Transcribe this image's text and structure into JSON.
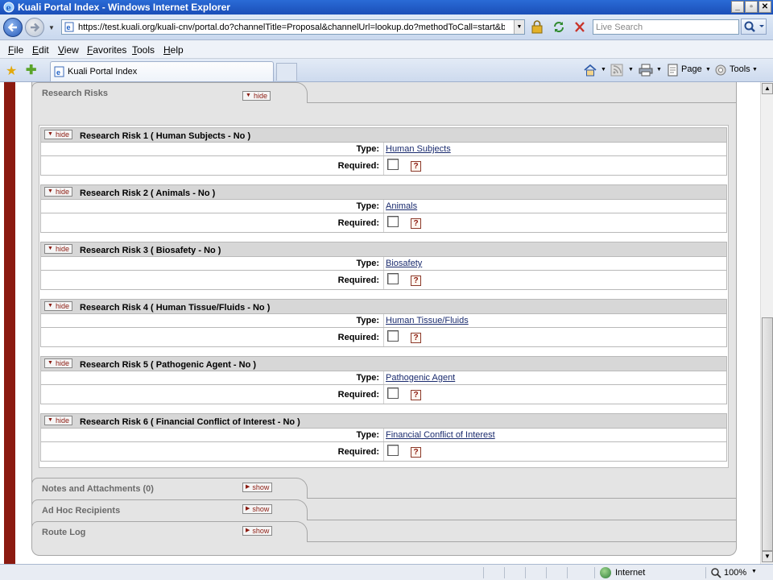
{
  "window": {
    "title": "Kuali Portal Index - Windows Internet Explorer"
  },
  "address": {
    "url": "https://test.kuali.org/kuali-cnv/portal.do?channelTitle=Proposal&channelUrl=lookup.do?methodToCall=start&businessObje",
    "search_placeholder": "Live Search"
  },
  "menu": [
    "File",
    "Edit",
    "View",
    "Favorites",
    "Tools",
    "Help"
  ],
  "tab": {
    "label": "Kuali Portal Index"
  },
  "commandbar": {
    "page_label": "Page",
    "tools_label": "Tools"
  },
  "research_risks": {
    "title": "Research Risks",
    "toggle": "hide",
    "type_label": "Type:",
    "required_label": "Required:",
    "help_glyph": "?",
    "items": [
      {
        "toggle": "hide",
        "title": "Research Risk 1 ( Human Subjects - No )",
        "type": "Human Subjects",
        "required": false
      },
      {
        "toggle": "hide",
        "title": "Research Risk 2 ( Animals - No )",
        "type": "Animals",
        "required": false
      },
      {
        "toggle": "hide",
        "title": "Research Risk 3 ( Biosafety - No )",
        "type": "Biosafety",
        "required": false
      },
      {
        "toggle": "hide",
        "title": "Research Risk 4 ( Human Tissue/Fluids - No )",
        "type": "Human Tissue/Fluids",
        "required": false
      },
      {
        "toggle": "hide",
        "title": "Research Risk 5 ( Pathogenic Agent - No )",
        "type": "Pathogenic Agent",
        "required": false
      },
      {
        "toggle": "hide",
        "title": "Research Risk 6 ( Financial Conflict of Interest - No )",
        "type": "Financial Conflict of Interest",
        "required": false
      }
    ]
  },
  "collapsed_sections": [
    {
      "title": "Notes and Attachments (0)",
      "toggle": "show"
    },
    {
      "title": "Ad Hoc Recipients",
      "toggle": "show"
    },
    {
      "title": "Route Log",
      "toggle": "show"
    }
  ],
  "status": {
    "zone": "Internet",
    "zoom": "100%"
  }
}
